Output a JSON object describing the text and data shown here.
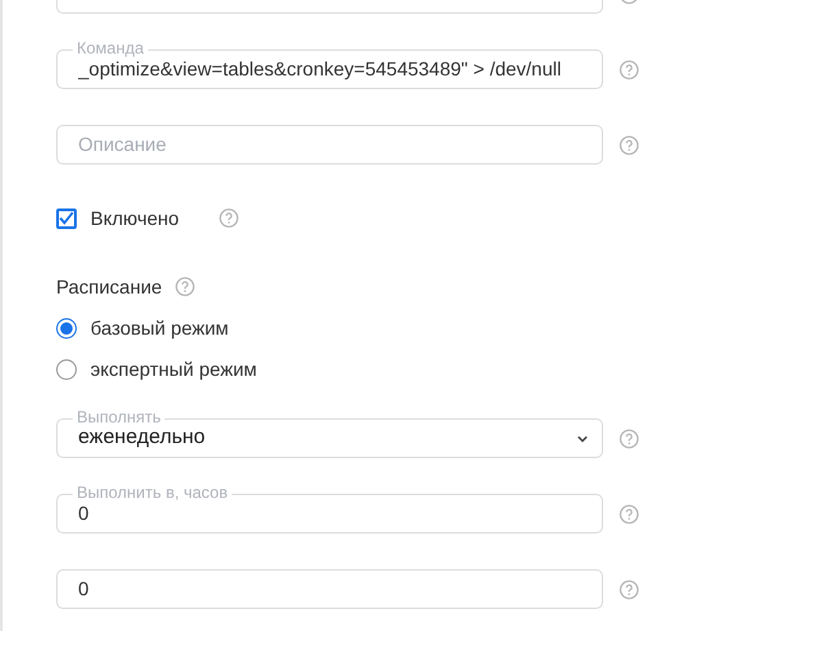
{
  "form": [
    {
      "kind": "text_field"
    },
    {
      "kind": "text_field",
      "label": "Команда",
      "value": "_optimize&view=tables&cronkey=545453489\" > /dev/null"
    },
    {
      "kind": "text_field",
      "placeholder": "Описание"
    },
    {
      "kind": "checkbox",
      "label": "Включено",
      "checked": true
    },
    {
      "kind": "heading",
      "label": "Расписание"
    },
    {
      "kind": "radio",
      "label": "базовый режим",
      "selected": true
    },
    {
      "kind": "radio",
      "label": "экспертный режим",
      "selected": false
    },
    {
      "kind": "select",
      "label": "Выполнять",
      "value": "еженедельно"
    },
    {
      "kind": "text_field",
      "label": "Выполнить в, часов",
      "value": "0"
    },
    {
      "kind": "text_field",
      "value": "0"
    }
  ]
}
